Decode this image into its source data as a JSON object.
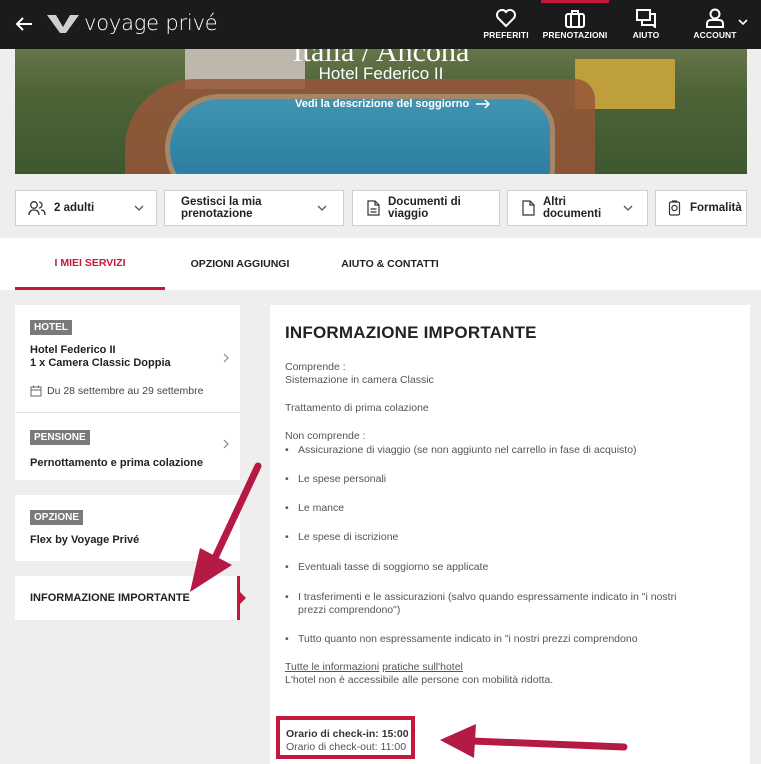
{
  "header": {
    "logo_text": "voyage privé",
    "nav": [
      {
        "label": "PREFERITI",
        "icon": "heart-icon"
      },
      {
        "label": "PRENOTAZIONI",
        "icon": "suitcase-icon"
      },
      {
        "label": "AIUTO",
        "icon": "chat-icon"
      },
      {
        "label": "ACCOUNT",
        "icon": "user-icon"
      }
    ]
  },
  "hero": {
    "title": "Italia / Ancona",
    "hotel": "Hotel Federico II",
    "link": "Vedi la descrizione del soggiorno"
  },
  "actions": {
    "guests": "2 adulti",
    "manage": "Gestisci la mia prenotazione",
    "travel_docs": "Documenti di viaggio",
    "other_docs": "Altri documenti",
    "formalities": "Formalità"
  },
  "tabs": [
    {
      "label": "I MIEI SERVIZI"
    },
    {
      "label": "OPZIONI AGGIUNGI"
    },
    {
      "label": "AIUTO & CONTATTI"
    }
  ],
  "sidebar": {
    "hotel": {
      "badge": "HOTEL",
      "line1": "Hotel Federico II",
      "line2": "1 x Camera Classic Doppia",
      "dates": "Du 28 settembre au 29 settembre"
    },
    "pension": {
      "badge": "PENSIONE",
      "title": "Pernottamento e prima colazione"
    },
    "option": {
      "badge": "OPZIONE",
      "title": "Flex by Voyage Privé"
    },
    "important": {
      "title": "INFORMAZIONE IMPORTANTE"
    }
  },
  "content": {
    "heading": "INFORMAZIONE IMPORTANTE",
    "includes_label": "Comprende :",
    "includes_1": "Sistemazione in camera Classic",
    "includes_2": "Trattamento di prima colazione",
    "excludes_label": "Non comprende :",
    "excludes": [
      "Assicurazione di viaggio (se non aggiunto nel carrello in fase di acquisto)",
      "Le spese personali",
      "Le mance",
      "Le spese di iscrizione",
      "Eventuali tasse di soggiorno se applicate",
      "I trasferimenti e le assicurazioni (salvo quando espressamente indicato in \"i nostri prezzi comprendono\")",
      "Tutto quanto non espressamente indicato in \"i nostri prezzi comprendono"
    ],
    "practical_prefix": "Tutte le informazioni",
    "practical_link": "pratiche sull'hotel",
    "mobility": "L'hotel non è accessibile alle persone con mobilità ridotta.",
    "checkin": "Orario di check-in: 15:00",
    "checkout": "Orario di check-out: 11:00"
  },
  "colors": {
    "accent": "#c4173c",
    "topbar": "#1b1b1b",
    "badge": "#7a7a7a"
  }
}
